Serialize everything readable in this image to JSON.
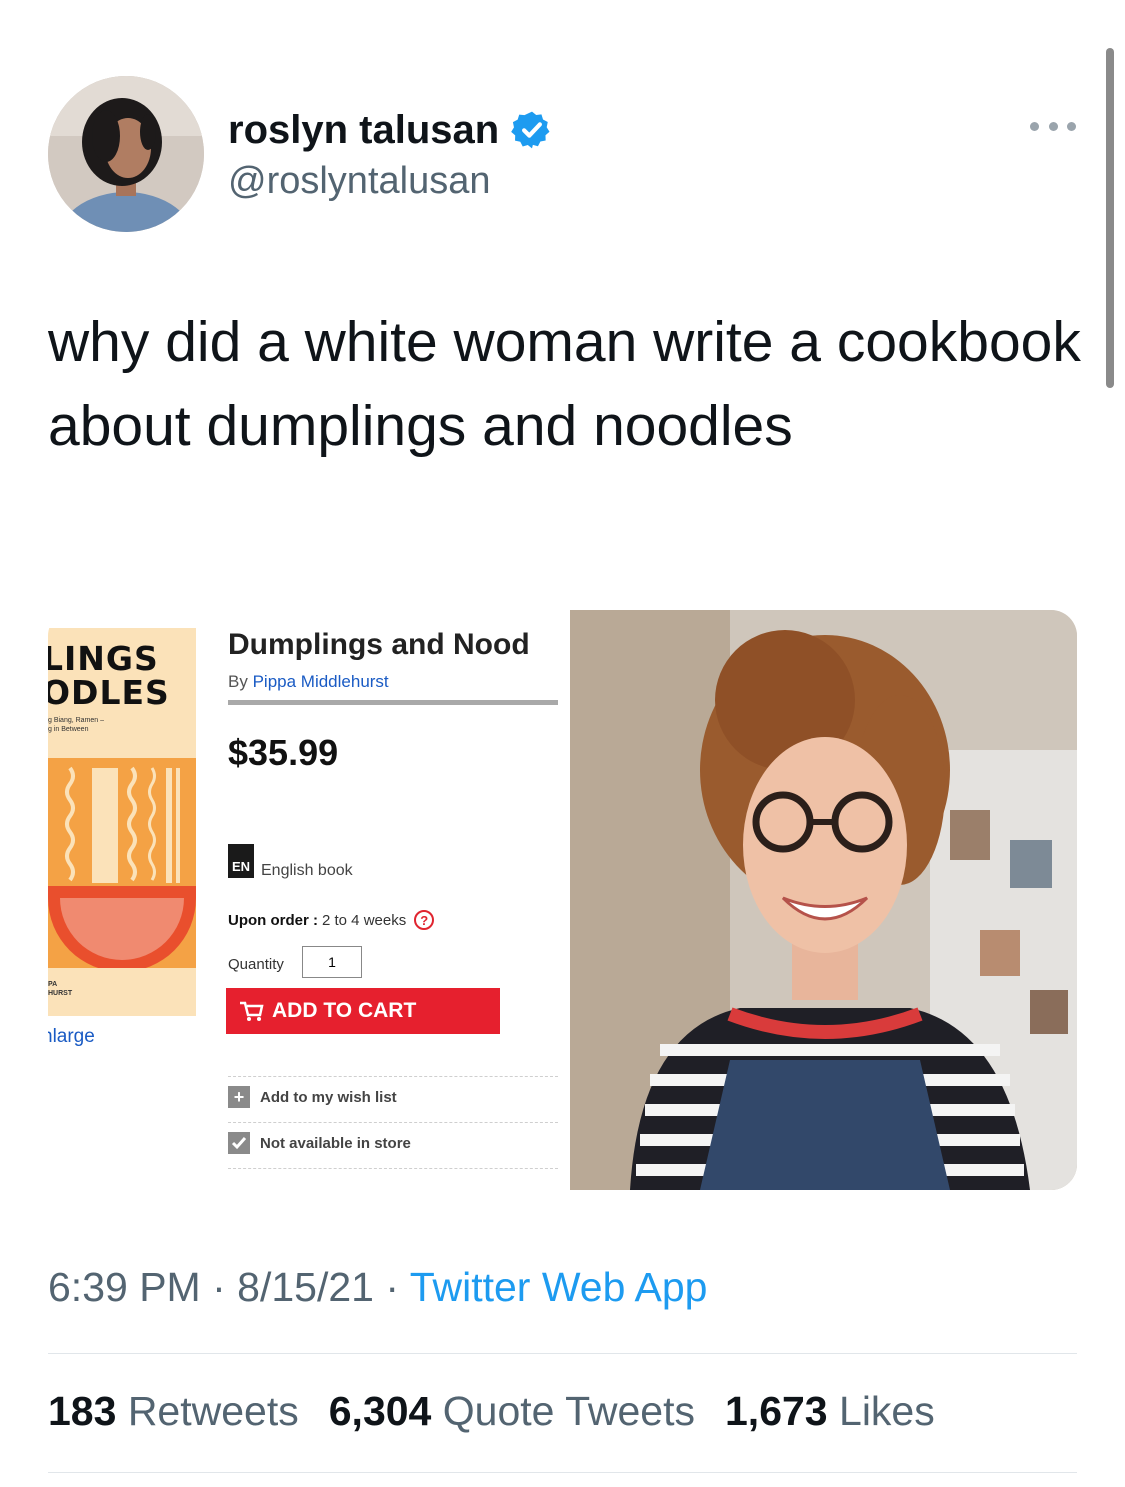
{
  "user": {
    "display_name": "roslyn talusan",
    "handle": "@roslyntalusan"
  },
  "tweet": {
    "text": "why did a white woman write a cookbook about dumplings and noodles"
  },
  "media": {
    "book_cover": {
      "title_lines": [
        "LINGS",
        "ODLES"
      ],
      "subtitle_lines": [
        "g Biang, Ramen –",
        "g in Between"
      ],
      "author_lines": [
        "PA",
        "HURST"
      ],
      "enlarge_label": "nlarge"
    },
    "product": {
      "title": "Dumplings and Nood",
      "by_label": "By",
      "author": "Pippa Middlehurst",
      "price": "$35.99",
      "language_code": "EN",
      "language_label": "English book",
      "order_label": "Upon order :",
      "order_value": "2 to 4 weeks",
      "help_symbol": "?",
      "quantity_label": "Quantity",
      "quantity_value": "1",
      "add_to_cart_label": "ADD TO CART",
      "wishlist_label": "Add to my wish list",
      "store_label": "Not available in store"
    }
  },
  "meta": {
    "time": "6:39 PM",
    "date": "8/15/21",
    "separator": "·",
    "source": "Twitter Web App"
  },
  "stats": {
    "retweets_count": "183",
    "retweets_label": "Retweets",
    "quotes_count": "6,304",
    "quotes_label": "Quote Tweets",
    "likes_count": "1,673",
    "likes_label": "Likes"
  },
  "colors": {
    "link_blue": "#1d9bf0",
    "secondary_text": "#536471",
    "cart_red": "#e6202e"
  }
}
